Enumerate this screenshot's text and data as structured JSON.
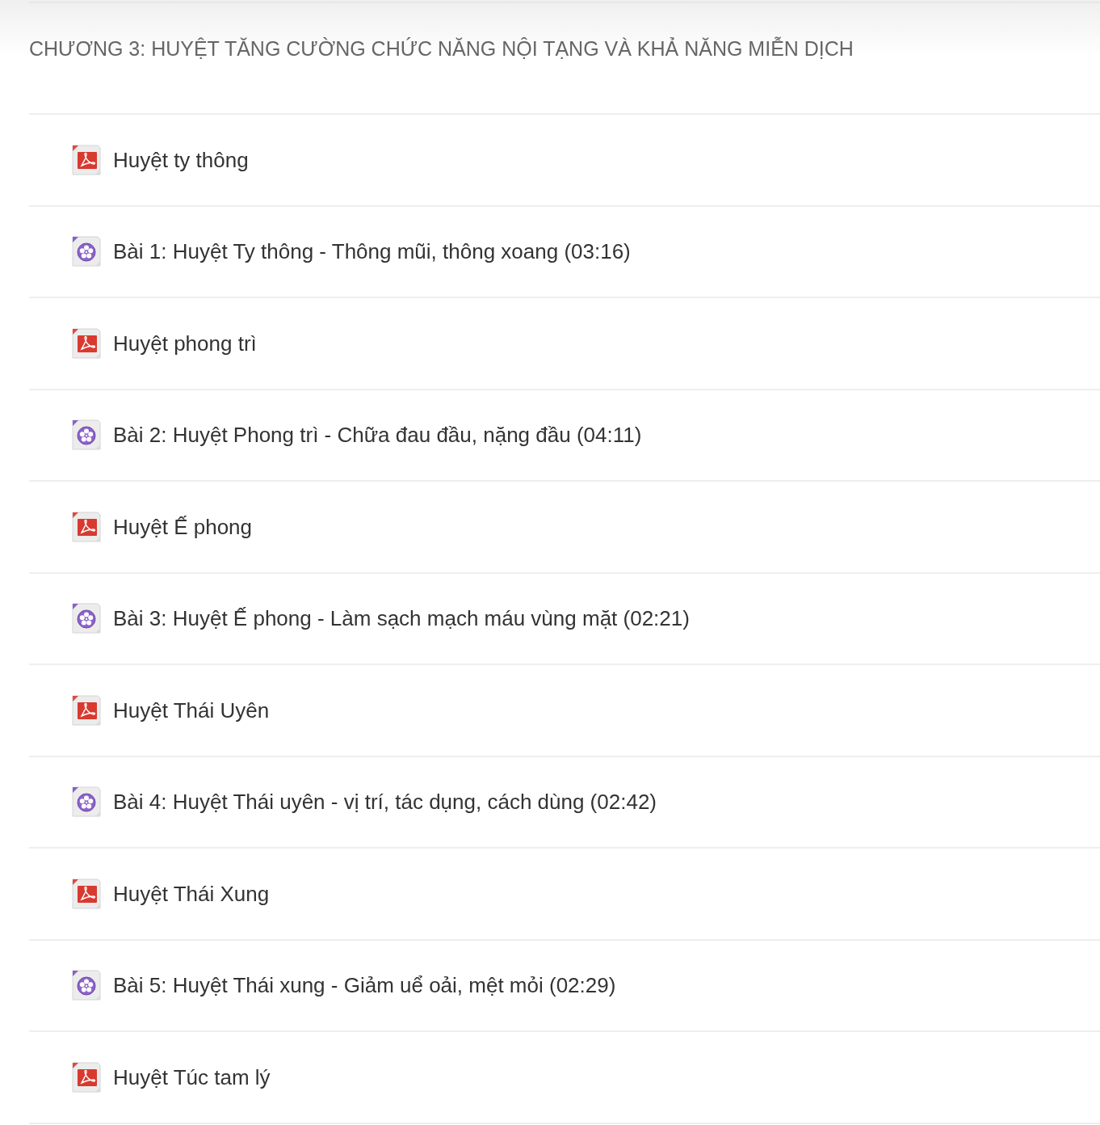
{
  "section": {
    "title": "CHƯƠNG 3: HUYỆT TĂNG CƯỜNG CHỨC NĂNG NỘI TẠNG VÀ KHẢ NĂNG MIỄN DỊCH"
  },
  "items": [
    {
      "kind": "pdf",
      "title": "Huyệt ty thông"
    },
    {
      "kind": "video",
      "title": "Bài 1: Huyệt Ty thông - Thông mũi, thông xoang (03:16)"
    },
    {
      "kind": "pdf",
      "title": "Huyệt phong trì"
    },
    {
      "kind": "video",
      "title": "Bài 2: Huyệt Phong trì - Chữa đau đầu, nặng đầu (04:11)"
    },
    {
      "kind": "pdf",
      "title": "Huyệt Ế phong"
    },
    {
      "kind": "video",
      "title": "Bài 3: Huyệt Ế phong - Làm sạch mạch máu vùng mặt (02:21)"
    },
    {
      "kind": "pdf",
      "title": "Huyệt Thái Uyên"
    },
    {
      "kind": "video",
      "title": "Bài 4: Huyệt Thái uyên - vị trí, tác dụng, cách dùng (02:42)"
    },
    {
      "kind": "pdf",
      "title": "Huyệt Thái Xung"
    },
    {
      "kind": "video",
      "title": "Bài 5: Huyệt Thái xung - Giảm uể oải, mệt mỏi (02:29)"
    },
    {
      "kind": "pdf",
      "title": "Huyệt Túc tam lý"
    }
  ]
}
